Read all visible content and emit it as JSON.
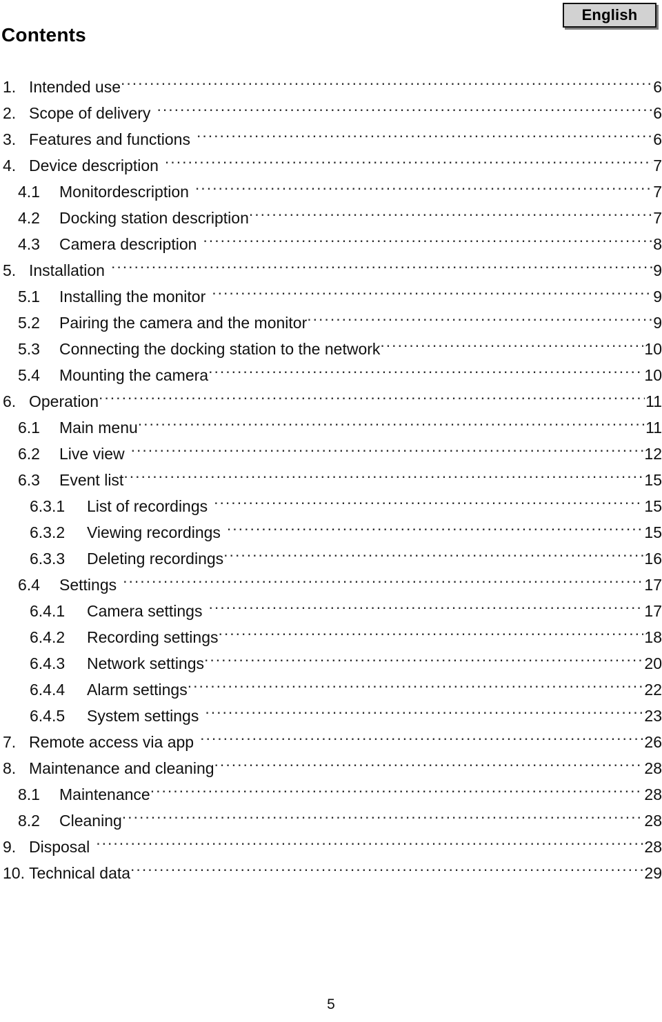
{
  "language_badge": {
    "label": "English"
  },
  "heading": {
    "title": "Contents"
  },
  "toc": {
    "entries": [
      {
        "number": "1.",
        "label": "Intended use",
        "page": "6",
        "level": 1,
        "gap": false
      },
      {
        "number": "2.",
        "label": "Scope of delivery",
        "page": "6",
        "level": 1,
        "gap": true
      },
      {
        "number": "3.",
        "label": "Features and functions",
        "page": "6",
        "level": 1,
        "gap": true
      },
      {
        "number": "4.",
        "label": "Device description",
        "page": "7",
        "level": 1,
        "gap": true
      },
      {
        "number": "4.1",
        "label": "Monitordescription",
        "page": "7",
        "level": 2,
        "gap": true
      },
      {
        "number": "4.2",
        "label": "Docking station description",
        "page": "7",
        "level": 2,
        "gap": false
      },
      {
        "number": "4.3",
        "label": "Camera description",
        "page": "8",
        "level": 2,
        "gap": true
      },
      {
        "number": "5.",
        "label": "Installation",
        "page": "9",
        "level": 1,
        "gap": true
      },
      {
        "number": "5.1",
        "label": "Installing the monitor",
        "page": "9",
        "level": 2,
        "gap": true
      },
      {
        "number": "5.2",
        "label": "Pairing the camera and the monitor",
        "page": "9",
        "level": 2,
        "gap": false
      },
      {
        "number": "5.3",
        "label": "Connecting the docking station to the network",
        "page": "10",
        "level": 2,
        "gap": false
      },
      {
        "number": "5.4",
        "label": "Mounting the camera",
        "page": "10",
        "level": 2,
        "gap": false
      },
      {
        "number": "6.",
        "label": "Operation",
        "page": "11",
        "level": 1,
        "gap": false
      },
      {
        "number": "6.1",
        "label": "Main menu",
        "page": "11",
        "level": 2,
        "gap": false
      },
      {
        "number": "6.2",
        "label": "Live view",
        "page": "12",
        "level": 2,
        "gap": true
      },
      {
        "number": "6.3",
        "label": "Event list",
        "page": "15",
        "level": 2,
        "gap": false
      },
      {
        "number": "6.3.1",
        "label": "List of recordings",
        "page": "15",
        "level": 3,
        "gap": true
      },
      {
        "number": "6.3.2",
        "label": "Viewing recordings",
        "page": "15",
        "level": 3,
        "gap": true
      },
      {
        "number": "6.3.3",
        "label": "Deleting recordings",
        "page": "16",
        "level": 3,
        "gap": false
      },
      {
        "number": "6.4",
        "label": "Settings",
        "page": "17",
        "level": 2,
        "gap": true
      },
      {
        "number": "6.4.1",
        "label": "Camera settings",
        "page": "17",
        "level": 3,
        "gap": true
      },
      {
        "number": "6.4.2",
        "label": "Recording settings",
        "page": "18",
        "level": 3,
        "gap": false
      },
      {
        "number": "6.4.3",
        "label": "Network settings",
        "page": "20",
        "level": 3,
        "gap": false
      },
      {
        "number": "6.4.4",
        "label": "Alarm settings",
        "page": "22",
        "level": 3,
        "gap": false
      },
      {
        "number": "6.4.5",
        "label": "System settings",
        "page": "23",
        "level": 3,
        "gap": true
      },
      {
        "number": "7.",
        "label": "Remote access via app",
        "page": "26",
        "level": 1,
        "gap": true
      },
      {
        "number": "8.",
        "label": "Maintenance and cleaning",
        "page": "28",
        "level": 1,
        "gap": false
      },
      {
        "number": "8.1",
        "label": "Maintenance",
        "page": "28",
        "level": 2,
        "gap": false
      },
      {
        "number": "8.2",
        "label": "Cleaning",
        "page": "28",
        "level": 2,
        "gap": false
      },
      {
        "number": "9.",
        "label": "Disposal",
        "page": "28",
        "level": 1,
        "gap": true
      },
      {
        "number": "10.",
        "label": "Technical data",
        "page": "29",
        "level": 1,
        "gap": false
      }
    ]
  },
  "footer": {
    "page_number": "5"
  }
}
